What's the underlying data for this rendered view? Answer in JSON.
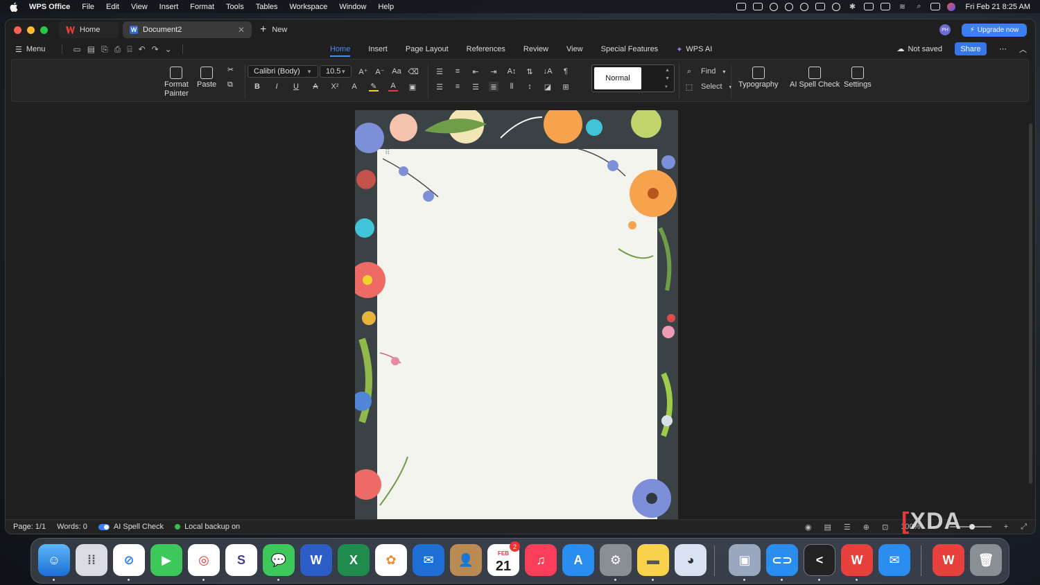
{
  "menubar": {
    "app_name": "WPS Office",
    "items": [
      "File",
      "Edit",
      "View",
      "Insert",
      "Format",
      "Tools",
      "Tables",
      "Workspace",
      "Window",
      "Help"
    ],
    "clock": "Fri Feb 21  8:25 AM"
  },
  "titlebar": {
    "tabs": [
      {
        "label": "Home",
        "icon": "wps-logo-icon"
      },
      {
        "label": "Document2",
        "icon": "word-doc-icon"
      }
    ],
    "new_label": "New",
    "avatar_initials": "PH",
    "upgrade_label": "Upgrade now"
  },
  "ribbon_tabs": {
    "menu_label": "Menu",
    "tabs": [
      "Home",
      "Insert",
      "Page Layout",
      "References",
      "Review",
      "View",
      "Special Features",
      "WPS AI"
    ],
    "active": "Home",
    "not_saved": "Not saved",
    "share_label": "Share"
  },
  "ribbon": {
    "format_painter": "Format\nPainter",
    "paste": "Paste",
    "font_name": "Calibri (Body)",
    "font_size": "10.5",
    "style_name": "Normal",
    "find": "Find",
    "select": "Select",
    "typography": "Typography",
    "ai_spell_check": "AI Spell Check",
    "settings": "Settings"
  },
  "statusbar": {
    "page": "Page: 1/1",
    "words": "Words: 0",
    "ai_spell": "AI Spell Check",
    "backup": "Local backup on",
    "zoom": "100%"
  },
  "dock": {
    "calendar_month": "FEB",
    "calendar_day": "21",
    "calendar_badge": "2"
  },
  "colors": {
    "accent": "#4c8df6",
    "upgrade": "#3c7ff2",
    "share": "#3576e8"
  }
}
